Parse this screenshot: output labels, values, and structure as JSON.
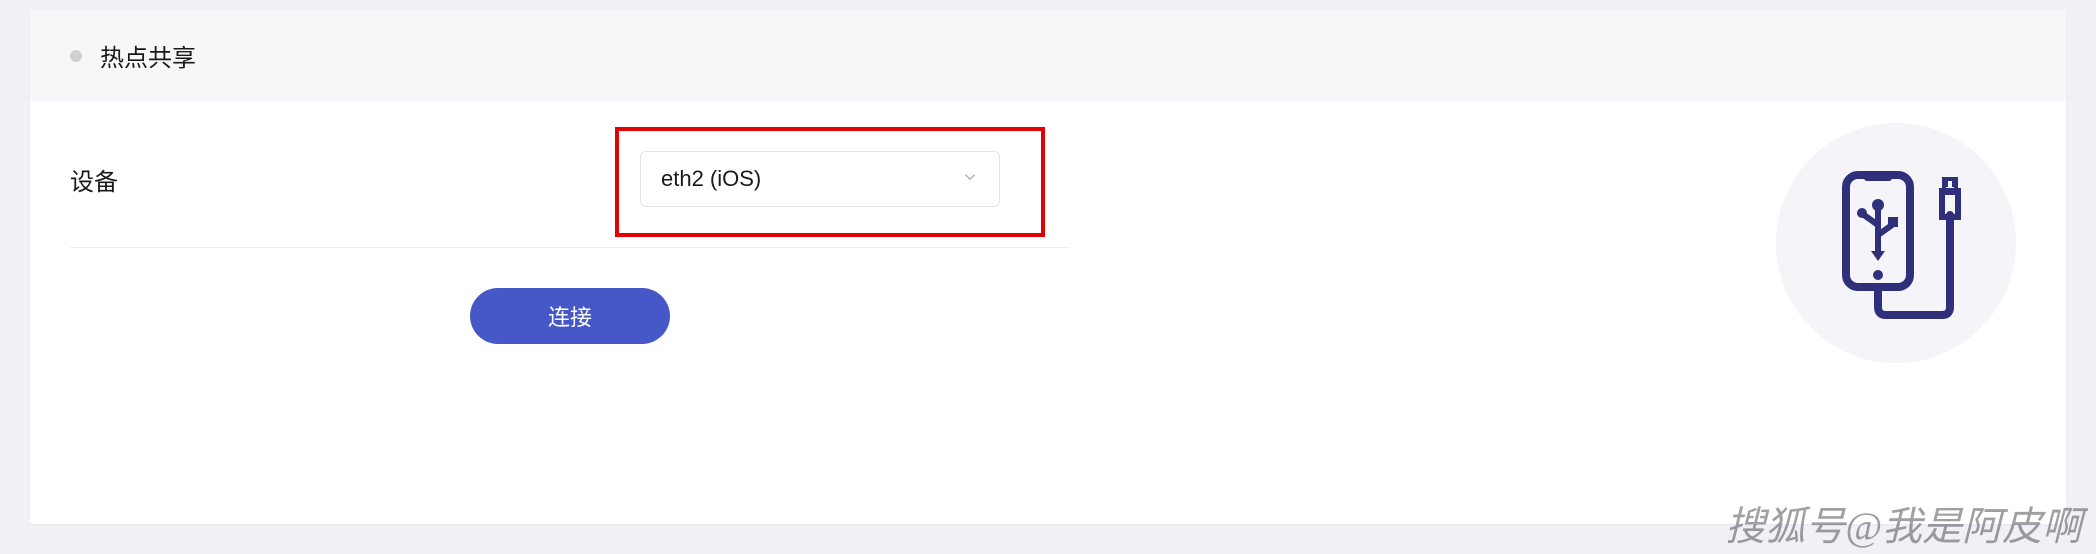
{
  "header": {
    "title": "热点共享"
  },
  "form": {
    "device_label": "设备",
    "device_value": "eth2 (iOS)"
  },
  "buttons": {
    "connect": "连接"
  },
  "watermark": "搜狐号@我是阿皮啊"
}
